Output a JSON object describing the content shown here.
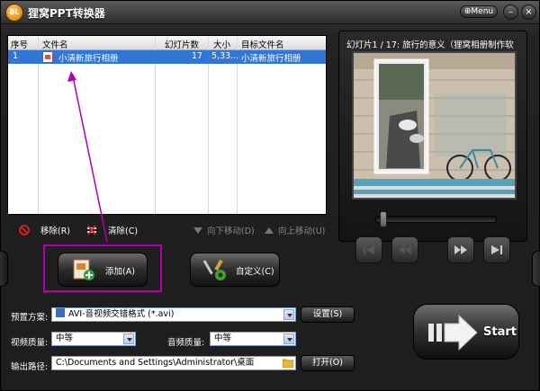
{
  "window": {
    "title": "狸窝PPT转换器",
    "logo_text": "BL",
    "menu_label": "Menu",
    "menu_glyph": "⊕",
    "minimize_glyph": "–",
    "close_glyph": "×"
  },
  "file_list": {
    "columns": [
      "序号",
      "文件名",
      "幻灯片数",
      "大小",
      "目标文件名"
    ],
    "rows": [
      {
        "index": "1",
        "name": "小清新旅行相册",
        "slides": "17",
        "size": "5,33...",
        "target": "小清新旅行相册"
      }
    ]
  },
  "list_toolbar": {
    "remove": "移除(R)",
    "clear": "清除(C)",
    "move_down": "向下移动(D)",
    "move_up": "向上移动(U)"
  },
  "preview": {
    "caption": "幻灯片1 / 17: 旅行的意义（狸窝相册制作软"
  },
  "actions": {
    "add": "添加(A)",
    "customize": "自定义(C)"
  },
  "settings": {
    "preset_label": "预置方案:",
    "preset_value": "AVI-音视频交错格式 (*.avi)",
    "preset_button": "设置(S)",
    "video_quality_label": "视频质量:",
    "video_quality_value": "中等",
    "audio_quality_label": "音频质量:",
    "audio_quality_value": "中等",
    "output_label": "输出路径:",
    "output_value": "C:\\Documents and Settings\\Administrator\\桌面",
    "open_button": "打开(O)"
  },
  "start": {
    "label": "Start"
  },
  "colors": {
    "selection": "#3175d6",
    "annotation": "#b000b0",
    "background": "#1c1c1c"
  }
}
